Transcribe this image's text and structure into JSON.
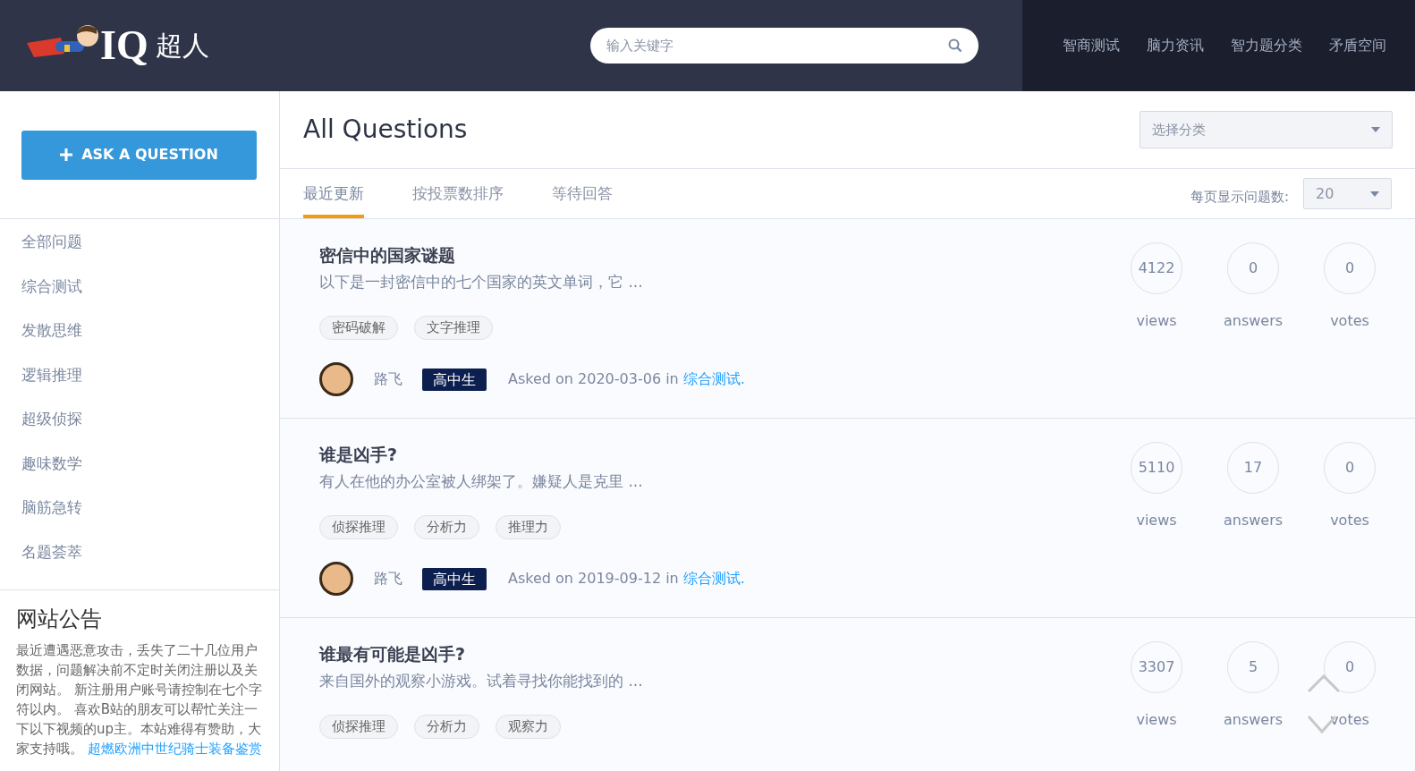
{
  "header": {
    "logo_text": "IQ",
    "logo_subtext": "超人",
    "search": {
      "placeholder": "输入关键字"
    },
    "nav": [
      {
        "label": "智商测试"
      },
      {
        "label": "脑力资讯"
      },
      {
        "label": "智力题分类"
      },
      {
        "label": "矛盾空间"
      }
    ]
  },
  "sidebar": {
    "ask_button": "ASK A QUESTION",
    "items": [
      {
        "label": "全部问题"
      },
      {
        "label": "综合测试"
      },
      {
        "label": "发散思维"
      },
      {
        "label": "逻辑推理"
      },
      {
        "label": "超级侦探"
      },
      {
        "label": "趣味数学"
      },
      {
        "label": "脑筋急转"
      },
      {
        "label": "名题荟萃"
      }
    ],
    "notice": {
      "title": "网站公告",
      "text": "最近遭遇恶意攻击，丢失了二十几位用户数据，问题解决前不定时关闭注册以及关闭网站。 新注册用户账号请控制在七个字符以内。 喜欢B站的朋友可以帮忙关注一下以下视频的up主。本站难得有赞助，大家支持哦。",
      "link": "超燃欧洲中世纪骑士装备鉴赏"
    }
  },
  "main": {
    "title": "All Questions",
    "category_select": {
      "placeholder": "选择分类"
    },
    "tabs": [
      {
        "label": "最近更新",
        "selected": true
      },
      {
        "label": "按投票数排序",
        "selected": false
      },
      {
        "label": "等待回答",
        "selected": false
      }
    ],
    "per_page": {
      "label": "每页显示问题数:",
      "value": "20"
    },
    "questions": [
      {
        "title": "密信中的国家谜题",
        "excerpt": "以下是一封密信中的七个国家的英文单词，它 ...",
        "tags": [
          "密码破解",
          "文字推理"
        ],
        "author": "路飞",
        "badge": "高中生",
        "asked": "Asked on 2020-03-06 in",
        "category": "综合测试.",
        "views": "4122",
        "views_label": "views",
        "answers": "0",
        "answers_label": "answers",
        "votes": "0",
        "votes_label": "votes"
      },
      {
        "title": "谁是凶手?",
        "excerpt": "有人在他的办公室被人绑架了。嫌疑人是克里 ...",
        "tags": [
          "侦探推理",
          "分析力",
          "推理力"
        ],
        "author": "路飞",
        "badge": "高中生",
        "asked": "Asked on 2019-09-12 in",
        "category": "综合测试.",
        "views": "5110",
        "views_label": "views",
        "answers": "17",
        "answers_label": "answers",
        "votes": "0",
        "votes_label": "votes"
      },
      {
        "title": "谁最有可能是凶手?",
        "excerpt": "来自国外的观察小游戏。试着寻找你能找到的 ...",
        "tags": [
          "侦探推理",
          "分析力",
          "观察力"
        ],
        "views": "3307",
        "views_label": "views",
        "answers": "5",
        "answers_label": "answers",
        "votes": "0",
        "votes_label": "votes"
      }
    ]
  }
}
